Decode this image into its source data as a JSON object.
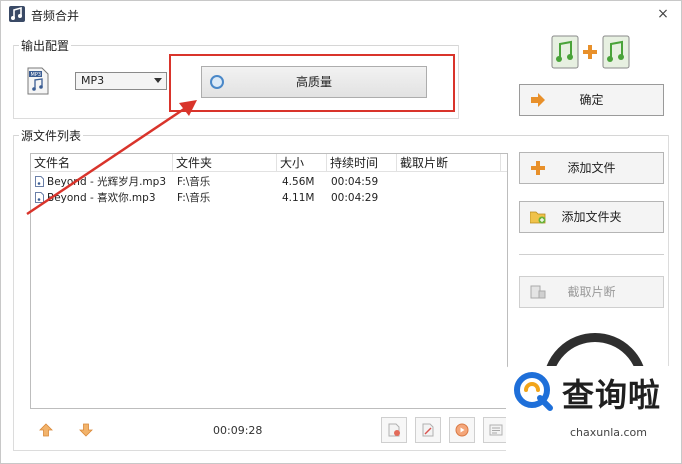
{
  "window": {
    "title": "音频合并",
    "close_glyph": "×"
  },
  "output": {
    "section_label": "输出配置",
    "format_value": "MP3",
    "quality_label": "高质量",
    "confirm_label": "确定"
  },
  "source": {
    "section_label": "源文件列表",
    "columns": [
      "文件名",
      "文件夹",
      "大小",
      "持续时间",
      "截取片断"
    ],
    "rows": [
      {
        "name": "Beyond - 光辉岁月.mp3",
        "folder": "F:\\音乐",
        "size": "4.56M",
        "duration": "00:04:59",
        "clip": ""
      },
      {
        "name": "Beyond - 喜欢你.mp3",
        "folder": "F:\\音乐",
        "size": "4.11M",
        "duration": "00:04:29",
        "clip": ""
      }
    ],
    "total_duration": "00:09:28"
  },
  "side": {
    "add_file_label": "添加文件",
    "add_folder_label": "添加文件夹",
    "clip_label": "截取片断"
  },
  "watermark": {
    "text": "查询啦",
    "url": "chaxunla.com"
  },
  "colors": {
    "highlight": "#d9342b",
    "accent_orange": "#e8902a",
    "accent_green": "#6bb33a",
    "watermark_blue": "#1e6fd9"
  }
}
